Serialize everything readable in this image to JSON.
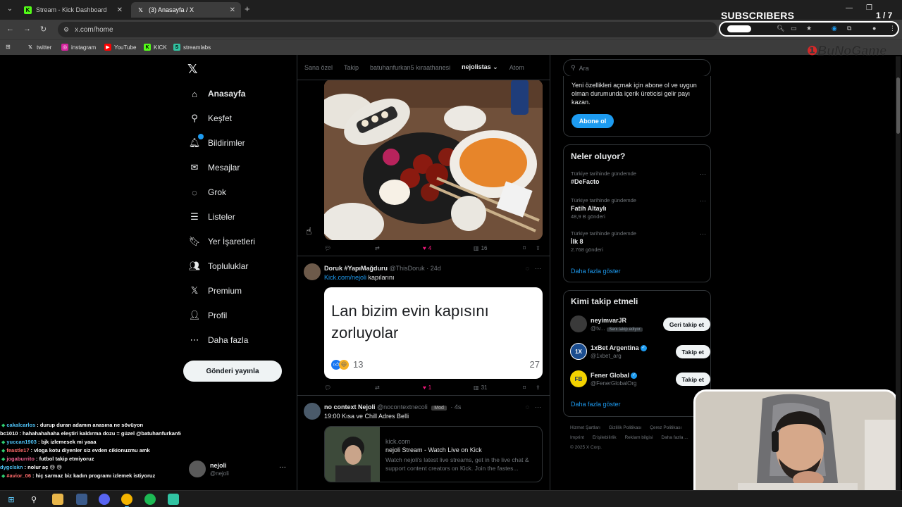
{
  "browser": {
    "tabs": [
      {
        "label": "Stream - Kick Dashboard",
        "favicon": "kick-icon",
        "active": false
      },
      {
        "label": "(3) Anasayfa / X",
        "favicon": "x-icon",
        "active": true
      }
    ],
    "url": "x.com/home",
    "bookmarks": [
      {
        "label": "twitter",
        "icon": "x-icon"
      },
      {
        "label": "instagram",
        "icon": "instagram-icon"
      },
      {
        "label": "YouTube",
        "icon": "youtube-icon"
      },
      {
        "label": "KICK",
        "icon": "kick-icon"
      },
      {
        "label": "streamlabs",
        "icon": "streamlabs-icon"
      }
    ]
  },
  "overlay": {
    "subscribers_label": "SUBSCRIBERS",
    "subscribers_count": "1 / 7",
    "brand": "BuNoGame"
  },
  "nav": {
    "items": [
      {
        "label": "Anasayfa",
        "icon": "home-icon",
        "active": true
      },
      {
        "label": "Keşfet",
        "icon": "search-icon",
        "active": false
      },
      {
        "label": "Bildirimler",
        "icon": "bell-icon",
        "active": false
      },
      {
        "label": "Mesajlar",
        "icon": "mail-icon",
        "active": false
      },
      {
        "label": "Grok",
        "icon": "grok-icon",
        "active": false
      },
      {
        "label": "Listeler",
        "icon": "list-icon",
        "active": false
      },
      {
        "label": "Yer İşaretleri",
        "icon": "bookmark-icon",
        "active": false
      },
      {
        "label": "Topluluklar",
        "icon": "people-icon",
        "active": false
      },
      {
        "label": "Premium",
        "icon": "x-icon",
        "active": false
      },
      {
        "label": "Profil",
        "icon": "person-icon",
        "active": false
      },
      {
        "label": "Daha fazla",
        "icon": "more-circle-icon",
        "active": false
      }
    ],
    "post_button": "Gönderi yayınla",
    "account": {
      "name": "nejoli",
      "handle": "@nejoli"
    }
  },
  "timeline": {
    "tabs": [
      {
        "label": "Sana özel",
        "active": false
      },
      {
        "label": "Takip",
        "active": false
      },
      {
        "label": "batuhanfurkan5 kıraathanesi",
        "active": false
      },
      {
        "label": "nejolistas",
        "active": true
      },
      {
        "label": "Atom",
        "active": false
      }
    ],
    "posts": [
      {
        "actions": {
          "replies": "",
          "reposts": "",
          "likes": "4",
          "views": "16"
        }
      },
      {
        "name": "Doruk #YapıMağduru",
        "handle": "@ThisDoruk",
        "time": "· 24d",
        "text_link": "Kick.com/nejoli",
        "text": " kapılarını",
        "card_text": "Lan bizim evin kapısını zorluyolar",
        "card_reaction_count": "13",
        "card_count_right": "27",
        "actions": {
          "replies": "",
          "reposts": "",
          "likes": "1",
          "views": "31"
        }
      },
      {
        "name": "no context Nejoli",
        "handle": "@nocontextnecoli",
        "mod": "Mod",
        "time": "· 4s",
        "text": "19:00 Kısa ve Chill Adres Belli",
        "link_card": {
          "domain": "kick.com",
          "title": "nejoli Stream - Watch Live on Kick",
          "description": "Watch nejoli's latest live streams, get in the live chat & support content creators on Kick. Join the fastes..."
        }
      }
    ]
  },
  "sidebar": {
    "search_placeholder": "Ara",
    "premium": {
      "text": "Yeni özellikleri açmak için abone ol ve uygun olman durumunda içerik üreticisi gelir payı kazan.",
      "button": "Abone ol"
    },
    "trends": {
      "title": "Neler oluyor?",
      "items": [
        {
          "context": "Türkiye tarihinde gündemde",
          "topic": "#DeFacto",
          "posts": ""
        },
        {
          "context": "Türkiye tarihinde gündemde",
          "topic": "Fatih Altaylı",
          "posts": "48,9 B gönderi"
        },
        {
          "context": "Türkiye tarihinde gündemde",
          "topic": "İlk 8",
          "posts": "2.768 gönderi"
        }
      ],
      "show_more": "Daha fazla göster"
    },
    "who_to_follow": {
      "title": "Kimi takip etmeli",
      "items": [
        {
          "name": "neyimvarJR",
          "handle": "@tv...",
          "follows_you": "Seni takip ediyor",
          "button": "Geri takip et",
          "verified": false,
          "avatar_color": "#3a3a3a"
        },
        {
          "name": "1xBet Argentina",
          "handle": "@1xbet_arg",
          "follows_you": "",
          "button": "Takip et",
          "verified": true,
          "avatar_color": "#1b4d8f",
          "avatar_text": "1X"
        },
        {
          "name": "Fener Global",
          "handle": "@FenerGlobalOrg",
          "follows_you": "",
          "button": "Takip et",
          "verified": true,
          "avatar_color": "#f2d200",
          "avatar_text": "FB"
        }
      ],
      "show_more": "Daha fazla göster"
    },
    "footer": [
      "Hizmet Şartları",
      "Gizlilik Politikası",
      "Çerez Politikası",
      "Imprint",
      "Erişilebilirlik",
      "Reklam bilgisi",
      "Daha fazla ...",
      "© 2025 X Corp."
    ]
  },
  "chat": [
    {
      "user": "cakalcarlos",
      "color": "#4fc3f7",
      "msg": ": durup duran adamın anasına ne sövüyon",
      "badge": true
    },
    {
      "user": "bc1010",
      "color": "#ffffff",
      "msg": ": hahahahahaha eleştiri kaldırma dozu = güzel @batuhanfurkan5",
      "badge": false
    },
    {
      "user": "yuccan1903",
      "color": "#4fc3f7",
      "msg": ": bjk izlemesek mi yaaa",
      "badge": true
    },
    {
      "user": "feastle17",
      "color": "#ff6b6b",
      "msg": ": vloga kotu diyenler siz evden cikionuzmu amk",
      "badge": true
    },
    {
      "user": "jogaburrito",
      "color": "#f06292",
      "msg": ": futbol takip etmiyoruz",
      "badge": true
    },
    {
      "user": "dygclskn",
      "color": "#4fc3f7",
      "msg": ": nolur aç 😢 😢",
      "badge": false
    },
    {
      "user": "#avior_06",
      "color": "#ff6b6b",
      "msg": ": hiç sarmaz biz kadın programı izlemek istiyoruz",
      "badge": true
    }
  ],
  "taskbar": [
    {
      "icon": "windows-start-icon"
    },
    {
      "icon": "search-icon"
    },
    {
      "icon": "file-explorer-icon"
    },
    {
      "icon": "app-icon"
    },
    {
      "icon": "discord-icon"
    },
    {
      "icon": "chrome-icon"
    },
    {
      "icon": "spotify-icon"
    },
    {
      "icon": "streaming-app-icon"
    }
  ]
}
